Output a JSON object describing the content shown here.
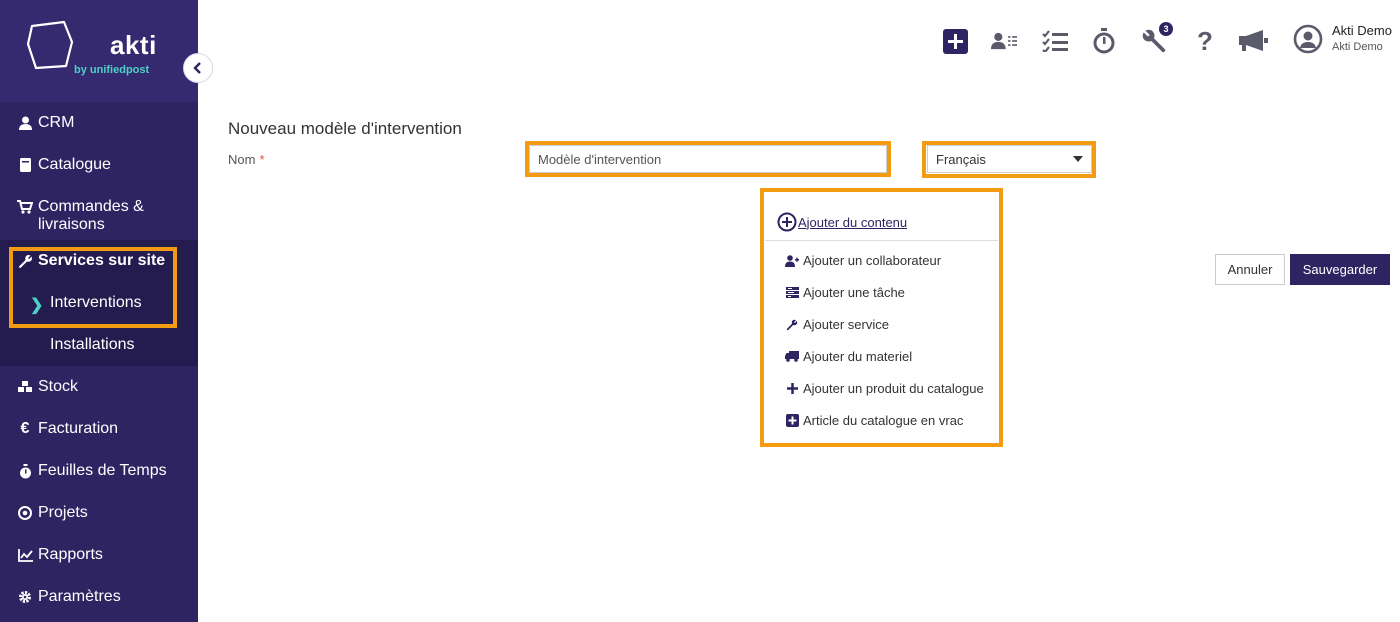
{
  "brand": {
    "name": "akti",
    "tagline": "by unifiedpost",
    "accent": "#4bd1c5",
    "primary": "#2f2462",
    "highlight": "#f39c12"
  },
  "sidebar": {
    "items": [
      {
        "label": "CRM",
        "icon": "user-icon"
      },
      {
        "label": "Catalogue",
        "icon": "book-icon"
      },
      {
        "label": "Commandes &",
        "label2": "livraisons",
        "icon": "cart-icon"
      },
      {
        "label": "Services sur site",
        "icon": "wrench-icon"
      },
      {
        "label": "Stock",
        "icon": "cubes-icon"
      },
      {
        "label": "Facturation",
        "icon": "euro-icon"
      },
      {
        "label": "Feuilles de Temps",
        "icon": "stopwatch-icon"
      },
      {
        "label": "Projets",
        "icon": "target-icon"
      },
      {
        "label": "Rapports",
        "icon": "chart-icon"
      },
      {
        "label": "Paramètres",
        "icon": "gear-icon"
      }
    ],
    "subitems": [
      {
        "label": "Interventions",
        "active": true
      },
      {
        "label": "Installations",
        "active": false
      }
    ]
  },
  "topbar": {
    "notification_count": "3",
    "user": {
      "name": "Akti Demo",
      "company": "Akti Demo"
    }
  },
  "form": {
    "title": "Nouveau modèle d'intervention",
    "name_label": "Nom",
    "required_mark": "*",
    "name_value": "Modèle d'intervention",
    "language_value": "Français"
  },
  "menu": {
    "header": "Ajouter du contenu",
    "items": [
      {
        "label": "Ajouter un collaborateur",
        "icon": "user-plus-icon"
      },
      {
        "label": "Ajouter une tâche",
        "icon": "tasks-icon"
      },
      {
        "label": "Ajouter service",
        "icon": "wrench-icon"
      },
      {
        "label": "Ajouter du materiel",
        "icon": "truck-icon"
      },
      {
        "label": "Ajouter un produit du catalogue",
        "icon": "plus-icon"
      },
      {
        "label": "Article du catalogue en vrac",
        "icon": "plus-square-icon"
      }
    ]
  },
  "actions": {
    "cancel": "Annuler",
    "save": "Sauvegarder"
  }
}
